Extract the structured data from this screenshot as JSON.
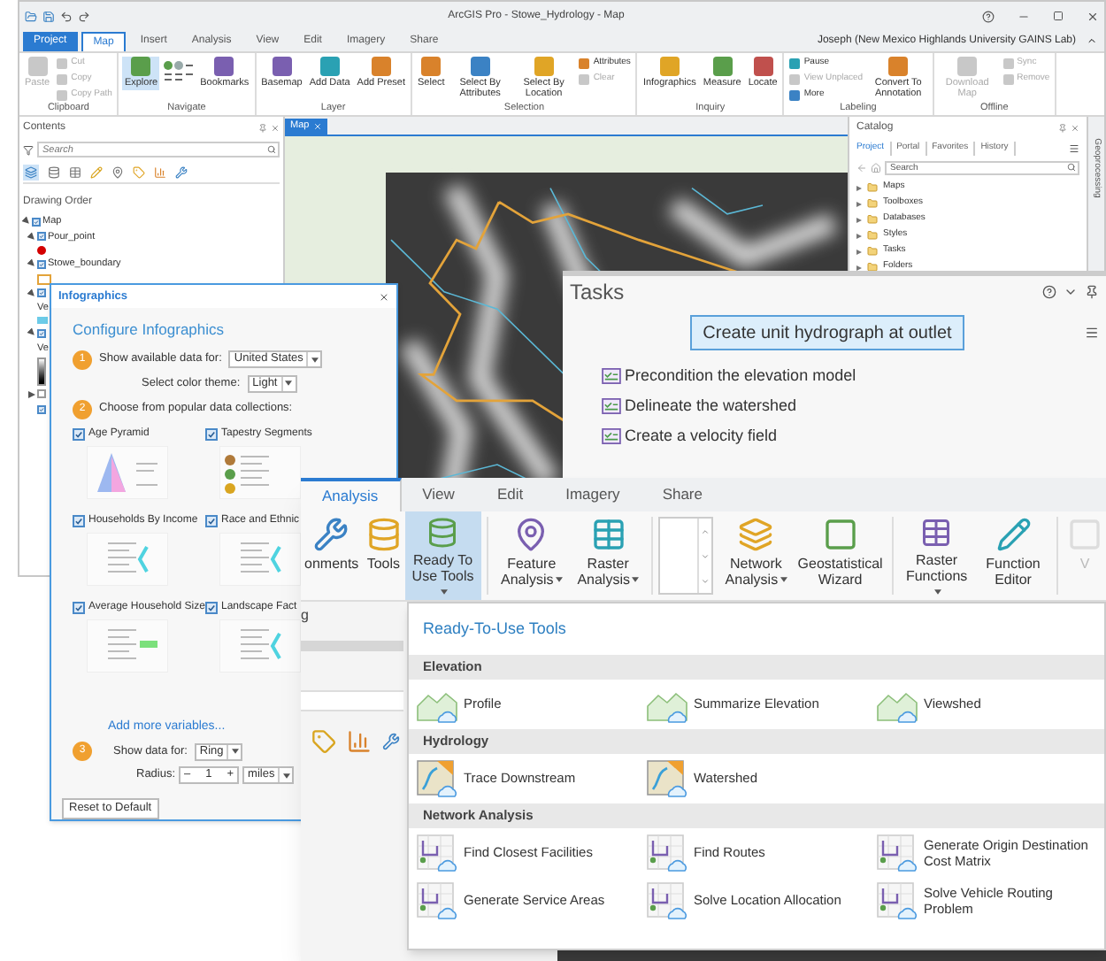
{
  "main_window": {
    "title": "ArcGIS Pro - Stowe_Hydrology - Map",
    "user": "Joseph (New Mexico Highlands University GAINS Lab)",
    "tabs": [
      {
        "label": "Project",
        "kind": "backstage",
        "selected": false
      },
      {
        "label": "Map",
        "kind": "tab",
        "selected": true
      },
      {
        "label": "Insert",
        "kind": "tab",
        "selected": false
      },
      {
        "label": "Analysis",
        "kind": "tab",
        "selected": false
      },
      {
        "label": "View",
        "kind": "tab",
        "selected": false
      },
      {
        "label": "Edit",
        "kind": "tab",
        "selected": false
      },
      {
        "label": "Imagery",
        "kind": "tab",
        "selected": false
      },
      {
        "label": "Share",
        "kind": "tab",
        "selected": false
      }
    ],
    "ribbon": [
      {
        "label": "Clipboard",
        "buttons": [
          {
            "label": "Paste",
            "kind": "large",
            "disabled": true,
            "active": false
          },
          {
            "label": "Cut",
            "kind": "small",
            "disabled": true,
            "active": false
          },
          {
            "label": "Copy",
            "kind": "small",
            "disabled": true,
            "active": false
          },
          {
            "label": "Copy Path",
            "kind": "small",
            "disabled": true,
            "active": false
          }
        ]
      },
      {
        "label": "Navigate",
        "buttons": [
          {
            "label": "Explore",
            "kind": "large",
            "disabled": false,
            "active": true
          },
          {
            "kind": "icon_grid"
          },
          {
            "label": "Bookmarks",
            "kind": "large",
            "disabled": false,
            "active": false
          }
        ]
      },
      {
        "label": "Layer",
        "buttons": [
          {
            "label": "Basemap",
            "kind": "large",
            "disabled": false,
            "active": false
          },
          {
            "label": "Add Data",
            "kind": "large",
            "disabled": false,
            "active": false
          },
          {
            "label": "Add Preset",
            "kind": "large",
            "disabled": false,
            "active": false
          }
        ]
      },
      {
        "label": "Selection",
        "buttons": [
          {
            "label": "Select",
            "kind": "large",
            "disabled": false,
            "active": false
          },
          {
            "label": "Select By Attributes",
            "kind": "large",
            "disabled": false,
            "active": false
          },
          {
            "label": "Select By Location",
            "kind": "large",
            "disabled": false,
            "active": false
          },
          {
            "label": "Attributes",
            "kind": "small",
            "disabled": false,
            "active": false
          },
          {
            "label": "Clear",
            "kind": "small",
            "disabled": true,
            "active": false
          }
        ]
      },
      {
        "label": "Inquiry",
        "buttons": [
          {
            "label": "Infographics",
            "kind": "large",
            "disabled": false,
            "active": false
          },
          {
            "label": "Measure",
            "kind": "large",
            "disabled": false,
            "active": false
          },
          {
            "label": "Locate",
            "kind": "large",
            "disabled": false,
            "active": false
          }
        ]
      },
      {
        "label": "Labeling",
        "buttons": [
          {
            "label": "Pause",
            "kind": "small",
            "disabled": false,
            "active": false
          },
          {
            "label": "View Unplaced",
            "kind": "small",
            "disabled": true,
            "active": false
          },
          {
            "label": "More",
            "kind": "small",
            "disabled": false,
            "active": false
          },
          {
            "label": "Convert To Annotation",
            "kind": "large",
            "disabled": false,
            "active": false
          }
        ]
      },
      {
        "label": "Offline",
        "buttons": [
          {
            "label": "Download Map",
            "kind": "large",
            "disabled": true,
            "active": false
          },
          {
            "label": "Sync",
            "kind": "small",
            "disabled": true,
            "active": false
          },
          {
            "label": "Remove",
            "kind": "small",
            "disabled": true,
            "active": false
          }
        ]
      }
    ],
    "contents": {
      "title": "Contents",
      "search_placeholder": "Search",
      "section": "Drawing Order",
      "tree": [
        {
          "name": "Map",
          "checked": true,
          "expanded": true,
          "children": [
            {
              "name": "Pour_point",
              "checked": true,
              "expanded": true,
              "legend": {
                "kind": "dot",
                "color": "#d40000"
              }
            },
            {
              "name": "Stowe_boundary",
              "checked": true,
              "expanded": true,
              "legend": {
                "kind": "outline",
                "color": "#e3a33a"
              }
            },
            {
              "checked": true,
              "expanded": true,
              "legend": {
                "kind": "swatch",
                "label": "Ve",
                "color": "#6ccbe8"
              }
            },
            {
              "checked": true,
              "expanded": true,
              "legend": {
                "kind": "ramp",
                "label": "Ve"
              }
            },
            {
              "checked": false,
              "expanded": false
            },
            {
              "checked": true
            }
          ]
        }
      ]
    },
    "map_tab": "Map",
    "catalog": {
      "title": "Catalog",
      "tabs": [
        {
          "label": "Project",
          "selected": true
        },
        {
          "label": "Portal",
          "selected": false
        },
        {
          "label": "Favorites",
          "selected": false
        },
        {
          "label": "History",
          "selected": false
        }
      ],
      "search_placeholder": "Search",
      "items": [
        "Maps",
        "Toolboxes",
        "Databases",
        "Styles",
        "Tasks",
        "Folders"
      ]
    },
    "side_tab": "Geoprocessing"
  },
  "infographics": {
    "title": "Infographics",
    "heading": "Configure Infographics",
    "step_1": {
      "number": "1",
      "fields": [
        {
          "label": "Show available data for:",
          "value": "United States"
        },
        {
          "label": "Select color theme:",
          "value": "Light"
        }
      ]
    },
    "step_2": {
      "number": "2",
      "label": "Choose from popular data collections:",
      "collections": [
        {
          "label": "Age Pyramid",
          "checked": true
        },
        {
          "label": "Tapestry Segments",
          "checked": true
        },
        {
          "label": "Households By Income",
          "checked": true
        },
        {
          "label": "Race and Ethnic",
          "checked": true
        },
        {
          "label": "Average Household Size",
          "checked": true
        },
        {
          "label": "Landscape Fact",
          "checked": true
        }
      ]
    },
    "add_more_link": "Add more variables...",
    "step_3": {
      "number": "3",
      "fields": [
        {
          "label": "Show data for:",
          "value": "Ring"
        }
      ],
      "radius": {
        "label": "Radius:",
        "decrement": "–",
        "value": "1",
        "increment": "+",
        "unit": "miles"
      }
    },
    "reset_button": "Reset to Default"
  },
  "tasks": {
    "title": "Tasks",
    "task_button": "Create unit hydrograph at outlet",
    "steps": [
      "Precondition the elevation model",
      "Delineate the watershed",
      "Create a velocity field"
    ]
  },
  "analysis_ribbon": {
    "tabs": [
      {
        "label": "Analysis",
        "selected": true
      },
      {
        "label": "View",
        "selected": false
      },
      {
        "label": "Edit",
        "selected": false
      },
      {
        "label": "Imagery",
        "selected": false
      },
      {
        "label": "Share",
        "selected": false
      }
    ],
    "buttons": [
      {
        "label": "onments",
        "kind": "large",
        "selected": false,
        "dropdown": false,
        "disabled": false
      },
      {
        "label": "Tools",
        "kind": "large",
        "selected": false,
        "dropdown": false,
        "disabled": false
      },
      {
        "label": "Ready To Use Tools",
        "kind": "large",
        "selected": true,
        "dropdown": true,
        "disabled": false
      },
      {
        "kind": "separator"
      },
      {
        "label": "Feature Analysis",
        "kind": "large",
        "selected": false,
        "dropdown": true,
        "disabled": false
      },
      {
        "label": "Raster Analysis",
        "kind": "large",
        "selected": false,
        "dropdown": true,
        "disabled": false
      },
      {
        "kind": "separator"
      },
      {
        "kind": "gallery"
      },
      {
        "label": "Network Analysis",
        "kind": "large",
        "selected": false,
        "dropdown": true,
        "disabled": false
      },
      {
        "label": "Geostatistical Wizard",
        "kind": "large",
        "selected": false,
        "dropdown": false,
        "disabled": false
      },
      {
        "kind": "separator"
      },
      {
        "label": "Raster Functions",
        "kind": "large",
        "selected": false,
        "dropdown": true,
        "disabled": false
      },
      {
        "label": "Function Editor",
        "kind": "large",
        "selected": false,
        "dropdown": false,
        "disabled": false
      },
      {
        "kind": "separator"
      },
      {
        "label": "V",
        "kind": "large",
        "selected": false,
        "dropdown": false,
        "disabled": true
      }
    ],
    "group_label": "g"
  },
  "ready_to_use_tools": {
    "title": "Ready-To-Use Tools",
    "sections": [
      {
        "label": "Elevation",
        "kind": "elevation",
        "tools": [
          "Profile",
          "Summarize Elevation",
          "Viewshed"
        ]
      },
      {
        "label": "Hydrology",
        "kind": "hydrology",
        "tools": [
          "Trace Downstream",
          "Watershed"
        ]
      },
      {
        "label": "Network Analysis",
        "kind": "network",
        "tools": [
          "Find Closest Facilities",
          "Find Routes",
          "Generate Origin Destination Cost Matrix",
          "Generate Service Areas",
          "Solve Location Allocation",
          "Solve Vehicle Routing Problem"
        ]
      }
    ]
  }
}
